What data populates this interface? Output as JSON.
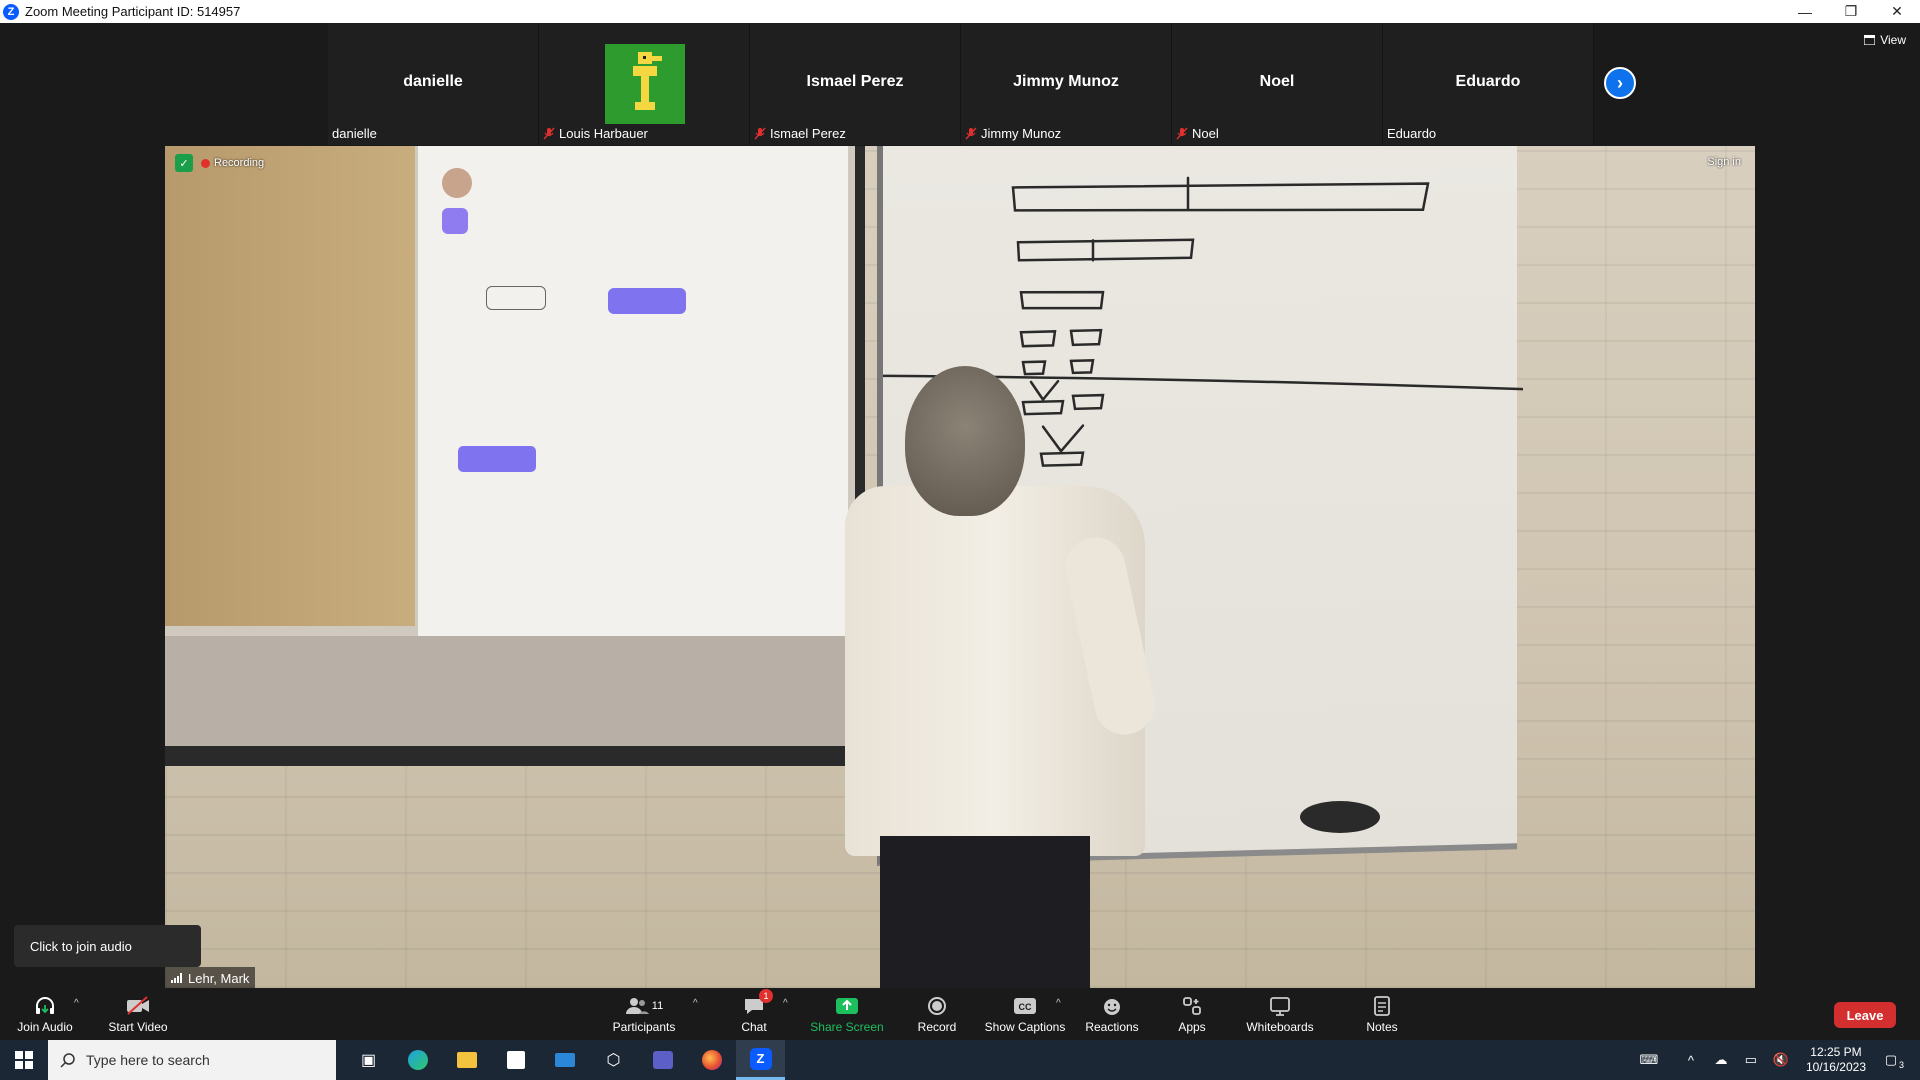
{
  "window": {
    "title": "Zoom Meeting Participant ID: 514957",
    "controls": [
      "—",
      "❐",
      "✕"
    ]
  },
  "meeting": {
    "view_label": "View",
    "participants_strip": [
      {
        "big": "danielle",
        "small": "danielle",
        "muted": false,
        "has_image": false
      },
      {
        "big": "",
        "small": "Louis Harbauer",
        "muted": true,
        "has_image": true
      },
      {
        "big": "Ismael Perez",
        "small": "Ismael Perez",
        "muted": true,
        "has_image": false
      },
      {
        "big": "Jimmy Munoz",
        "small": "Jimmy Munoz",
        "muted": true,
        "has_image": false
      },
      {
        "big": "Noel",
        "small": "Noel",
        "muted": true,
        "has_image": false
      },
      {
        "big": "Eduardo",
        "small": "Eduardo",
        "muted": false,
        "has_image": false
      }
    ],
    "video": {
      "recording_label": "Recording",
      "sign_in": "Sign in",
      "speaker_name": "Lehr, Mark"
    },
    "join_audio_tooltip": "Click to join audio"
  },
  "toolbar": {
    "join_audio": "Join Audio",
    "start_video": "Start Video",
    "participants": "Participants",
    "participants_count": "11",
    "chat": "Chat",
    "chat_badge": "1",
    "share_screen": "Share Screen",
    "record": "Record",
    "show_captions": "Show Captions",
    "reactions": "Reactions",
    "apps": "Apps",
    "whiteboards": "Whiteboards",
    "notes": "Notes",
    "leave": "Leave",
    "colors": {
      "share": "#1dbe5e",
      "leave": "#d32f2f",
      "accent": "#0e72ed"
    }
  },
  "taskbar": {
    "search_placeholder": "Type here to search",
    "time": "12:25 PM",
    "date": "10/16/2023",
    "notification_count": "3"
  }
}
